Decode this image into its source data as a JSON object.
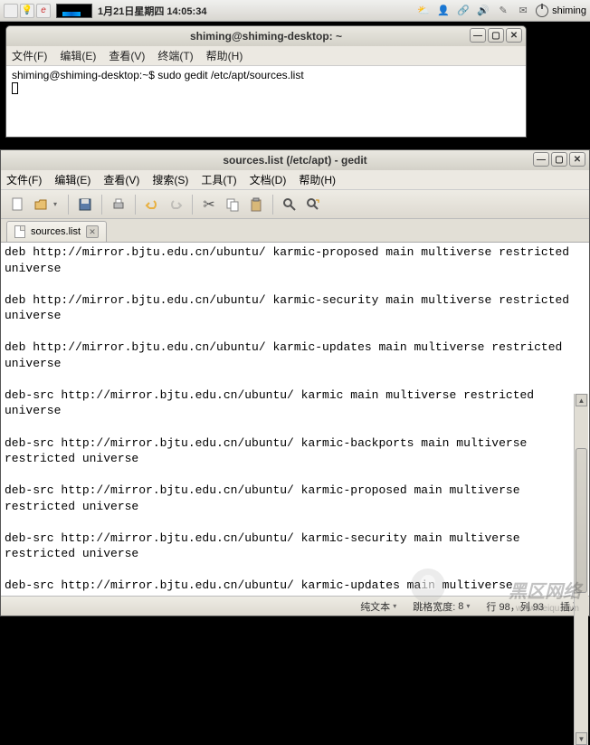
{
  "taskbar": {
    "date_time": "1月21日星期四 14:05:34",
    "username": "shiming"
  },
  "terminal": {
    "title": "shiming@shiming-desktop: ~",
    "menu": {
      "file": "文件(F)",
      "edit": "编辑(E)",
      "view": "查看(V)",
      "terminal": "终端(T)",
      "help": "帮助(H)"
    },
    "prompt": "shiming@shiming-desktop:~$ ",
    "command": "sudo gedit /etc/apt/sources.list"
  },
  "gedit": {
    "title": "sources.list (/etc/apt) - gedit",
    "menu": {
      "file": "文件(F)",
      "edit": "编辑(E)",
      "view": "查看(V)",
      "search": "搜索(S)",
      "tools": "工具(T)",
      "documents": "文档(D)",
      "help": "帮助(H)"
    },
    "tab": {
      "name": "sources.list"
    },
    "content": "deb http://mirror.bjtu.edu.cn/ubuntu/ karmic-proposed main multiverse restricted universe\n\ndeb http://mirror.bjtu.edu.cn/ubuntu/ karmic-security main multiverse restricted universe\n\ndeb http://mirror.bjtu.edu.cn/ubuntu/ karmic-updates main multiverse restricted universe\n\ndeb-src http://mirror.bjtu.edu.cn/ubuntu/ karmic main multiverse restricted universe\n\ndeb-src http://mirror.bjtu.edu.cn/ubuntu/ karmic-backports main multiverse restricted universe\n\ndeb-src http://mirror.bjtu.edu.cn/ubuntu/ karmic-proposed main multiverse restricted universe\n\ndeb-src http://mirror.bjtu.edu.cn/ubuntu/ karmic-security main multiverse restricted universe\n\ndeb-src http://mirror.bjtu.edu.cn/ubuntu/ karmic-updates main multiverse restricted universe",
    "status": {
      "syntax": "纯文本",
      "tabwidth_label": "跳格宽度:",
      "tabwidth_value": "8",
      "position": "行 98，列 93",
      "mode": "插入"
    }
  },
  "watermark": {
    "main": "黑区网络",
    "sub": "www.heiqu.com"
  }
}
